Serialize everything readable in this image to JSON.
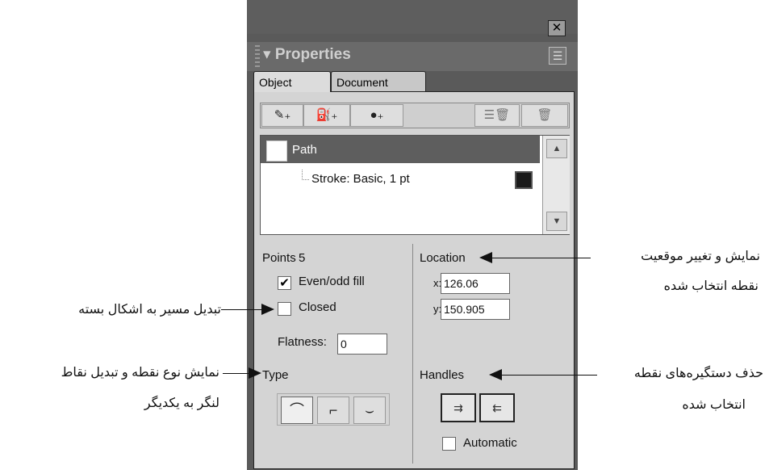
{
  "window": {
    "close_symbol": "✕"
  },
  "panel": {
    "title": "▾ Properties",
    "options_icon": "options-menu-icon"
  },
  "tabs": [
    {
      "label": "Object"
    },
    {
      "label": "Document"
    }
  ],
  "toolbar": {
    "add_stroke": "✎₊",
    "add_fill": "⛽₊",
    "add_effect": "●₊",
    "delete_multiple": "☰🗑",
    "delete": "🗑"
  },
  "tree": {
    "path_label": "Path",
    "stroke_label": "Stroke: Basic, 1 pt",
    "scroll_up": "▲",
    "scroll_down": "▼"
  },
  "points": {
    "label": "Points",
    "count": "5",
    "evenodd_label": "Even/odd fill",
    "evenodd_checked": "✔",
    "closed_label": "Closed",
    "flatness_label": "Flatness:",
    "flatness_value": "0"
  },
  "type": {
    "label": "Type",
    "curve": "⌒",
    "corner": "⌐",
    "connector": "⌣"
  },
  "location": {
    "label": "Location",
    "x_label": "x:",
    "x_value": "126.06",
    "y_label": "y:",
    "y_value": "150.905"
  },
  "handles": {
    "label": "Handles",
    "btn1": "⇉",
    "btn2": "⇇",
    "automatic_label": "Automatic"
  },
  "annotations": {
    "location_line1": "نمایش و تغییر موقعیت",
    "location_line2": "نقطه انتخاب شده",
    "closed": "تبدیل مسیر به اشکال بسته",
    "type_line1": "نمایش نوع نقطه و تبدیل نقاط",
    "type_line2": "لنگر به یکدیگر",
    "handles_line1": "حذف دستگیره‌های نقطه",
    "handles_line2": "انتخاب شده"
  }
}
